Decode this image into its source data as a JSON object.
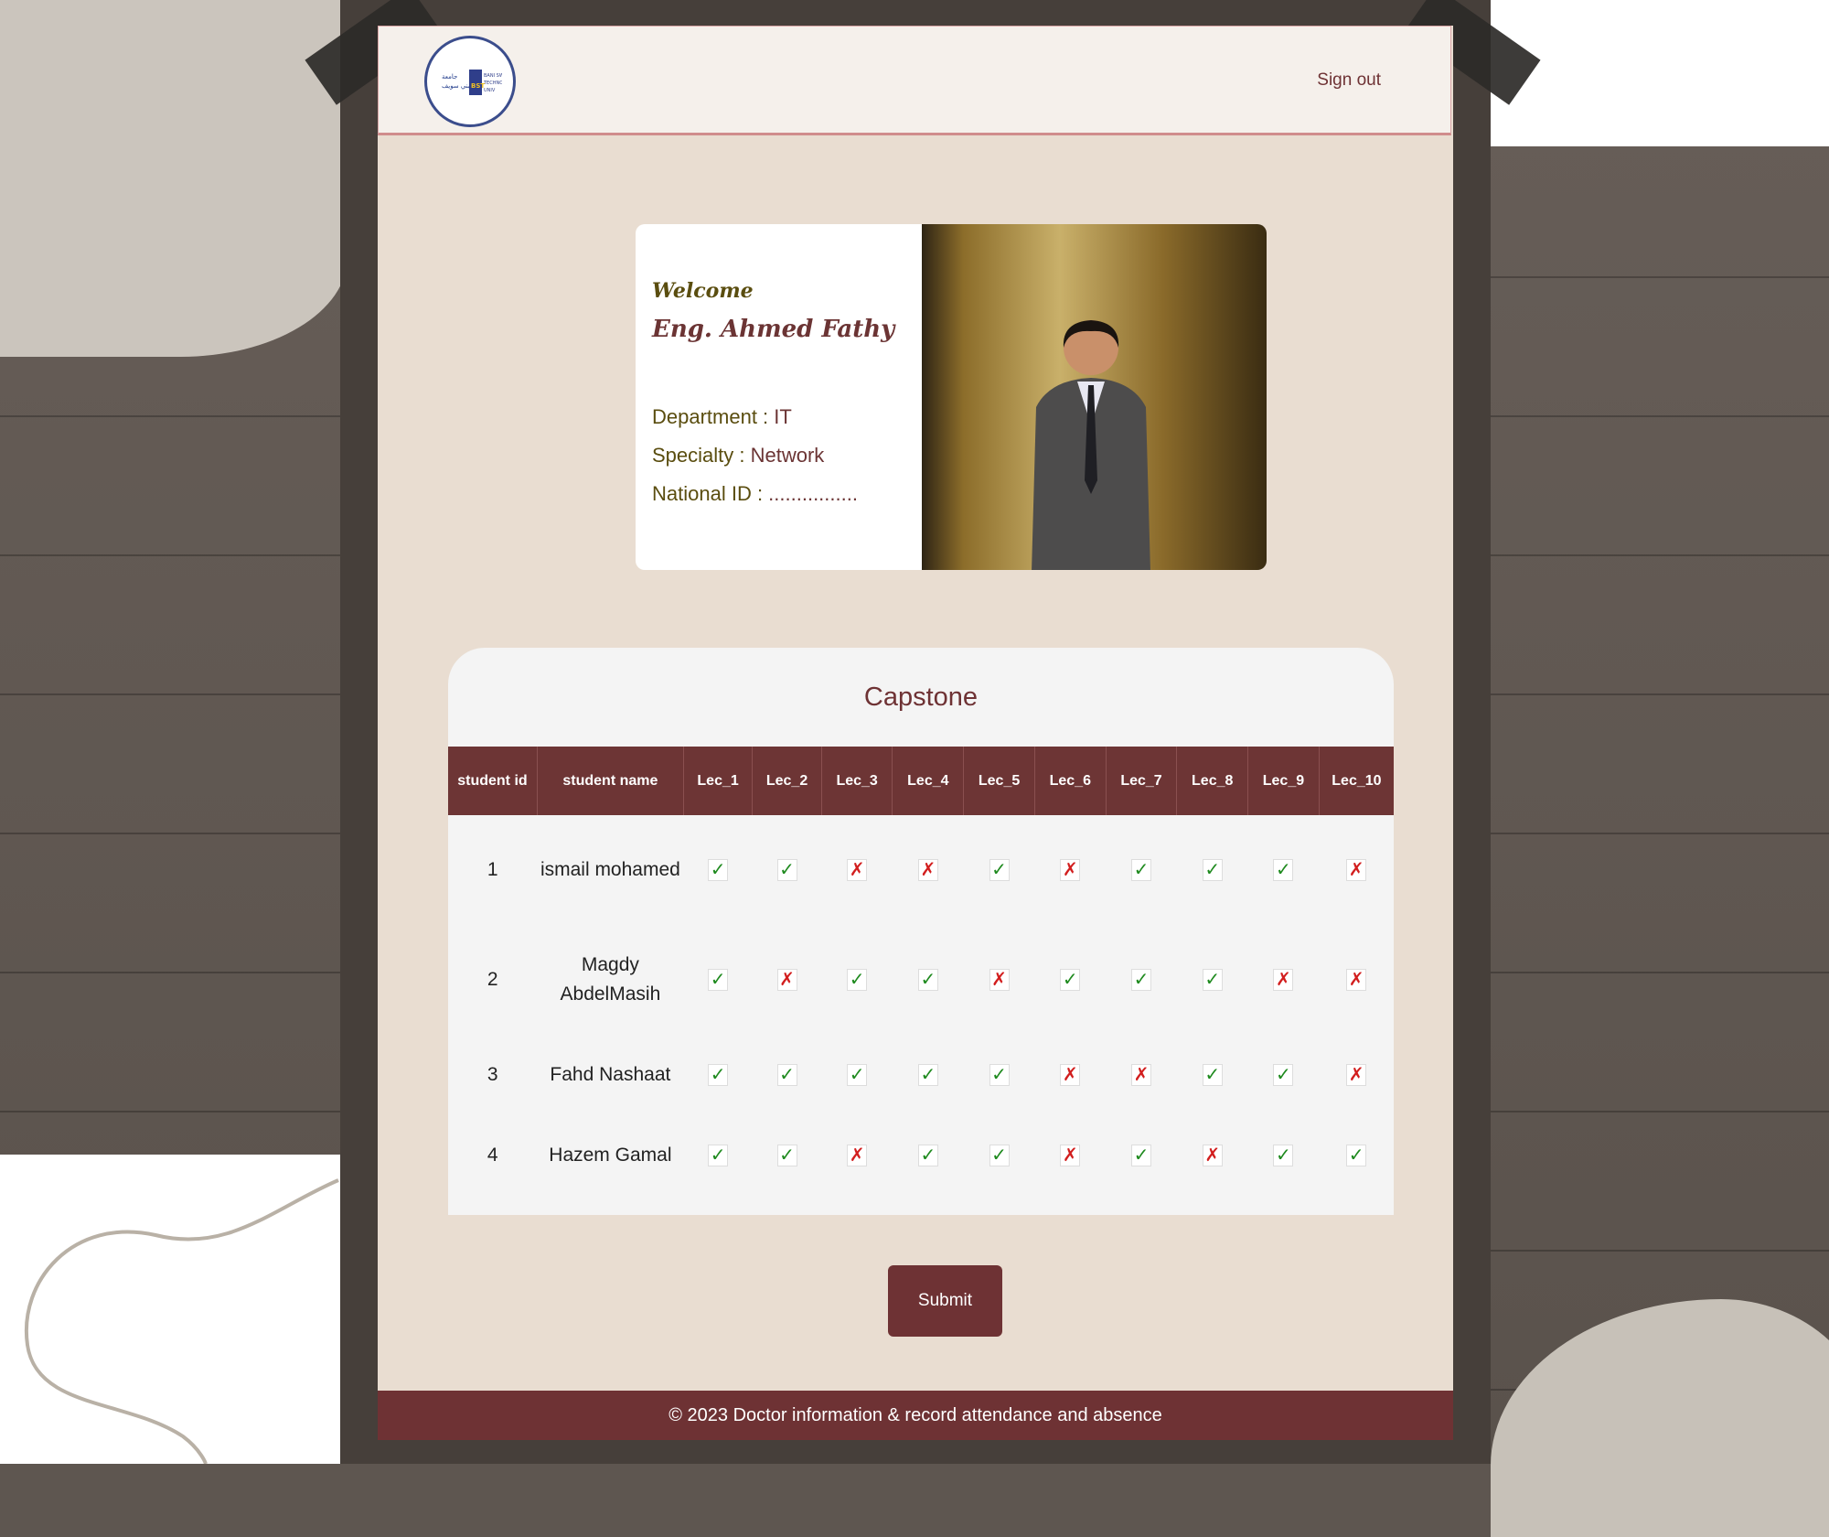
{
  "header": {
    "sign_out_label": "Sign out"
  },
  "profile": {
    "welcome": "Welcome",
    "name": "Eng. Ahmed Fathy",
    "department_label": "Department : ",
    "department_value": "IT",
    "specialty_label": "Specialty : ",
    "specialty_value": "Network",
    "national_id_label": "National ID : ",
    "national_id_value": "................"
  },
  "attendance": {
    "title": "Capstone",
    "columns": [
      "student id",
      "student name",
      "Lec_1",
      "Lec_2",
      "Lec_3",
      "Lec_4",
      "Lec_5",
      "Lec_6",
      "Lec_7",
      "Lec_8",
      "Lec_9",
      "Lec_10"
    ],
    "rows": [
      {
        "id": "1",
        "name": "ismail mohamed",
        "marks": [
          true,
          true,
          false,
          false,
          true,
          false,
          true,
          true,
          true,
          false
        ]
      },
      {
        "id": "2",
        "name": "Magdy AbdelMasih",
        "marks": [
          true,
          false,
          true,
          true,
          false,
          true,
          true,
          true,
          false,
          false
        ]
      },
      {
        "id": "3",
        "name": "Fahd Nashaat",
        "marks": [
          true,
          true,
          true,
          true,
          true,
          false,
          false,
          true,
          true,
          false
        ]
      },
      {
        "id": "4",
        "name": "Hazem Gamal",
        "marks": [
          true,
          true,
          false,
          true,
          true,
          false,
          true,
          false,
          true,
          true
        ]
      }
    ]
  },
  "submit_label": "Submit",
  "footer_text": "© 2023 Doctor information & record attendance and absence",
  "colors": {
    "accent": "#6e3234",
    "present": "#1e8a1e",
    "absent": "#d21e1e"
  },
  "icons": {
    "present": "check-icon",
    "absent": "cross-icon"
  }
}
